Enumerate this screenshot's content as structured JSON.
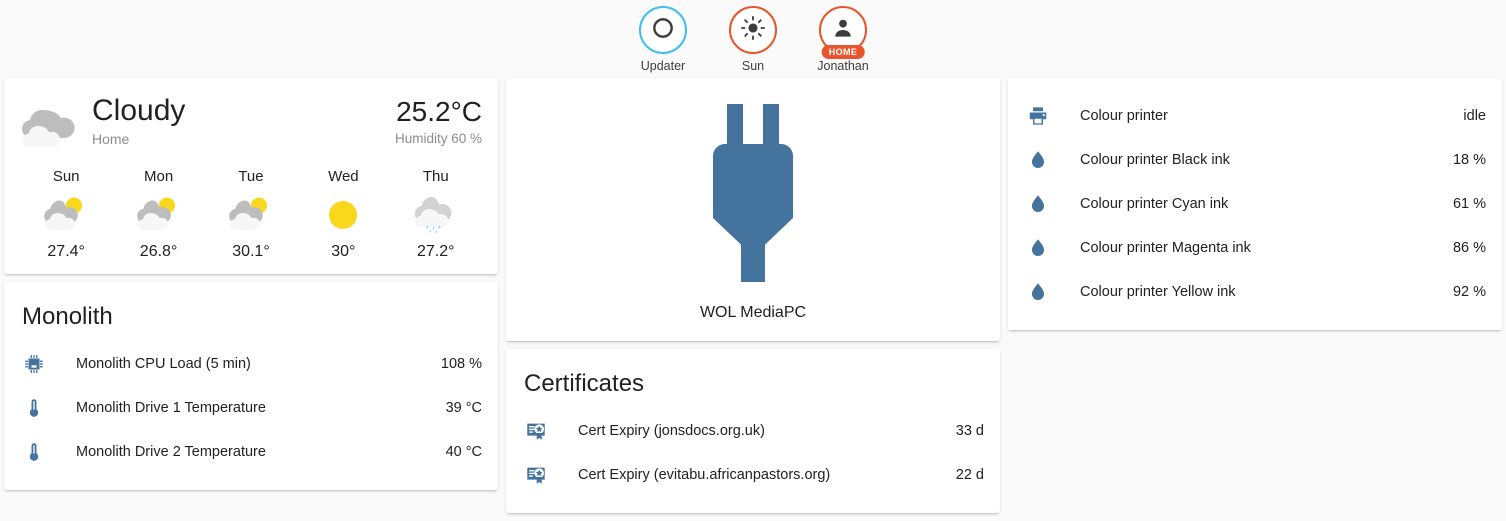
{
  "badges": [
    {
      "name": "Updater",
      "icon": "circle-outline-icon",
      "color": "#41bdf5",
      "pill": null
    },
    {
      "name": "Sun",
      "icon": "sun-icon",
      "color": "#e8552d",
      "pill": null
    },
    {
      "name": "Jonathan",
      "icon": "person-icon",
      "color": "#e8552d",
      "pill": "HOME"
    }
  ],
  "weather": {
    "state": "Cloudy",
    "location": "Home",
    "temperature": "25.2°C",
    "humidity": "Humidity 60 %",
    "icon": "cloudy-icon",
    "forecast": [
      {
        "day": "Sun",
        "icon": "partly-cloudy-icon",
        "temp": "27.4°"
      },
      {
        "day": "Mon",
        "icon": "partly-cloudy-icon",
        "temp": "26.8°"
      },
      {
        "day": "Tue",
        "icon": "partly-cloudy-icon",
        "temp": "30.1°"
      },
      {
        "day": "Wed",
        "icon": "sunny-icon",
        "temp": "30°"
      },
      {
        "day": "Thu",
        "icon": "rainy-icon",
        "temp": "27.2°"
      }
    ]
  },
  "monolith": {
    "title": "Monolith",
    "rows": [
      {
        "icon": "cpu-chip-icon",
        "name": "Monolith CPU Load (5 min)",
        "state": "108 %"
      },
      {
        "icon": "thermometer-icon",
        "name": "Monolith Drive 1 Temperature",
        "state": "39 °C"
      },
      {
        "icon": "thermometer-icon",
        "name": "Monolith Drive 2 Temperature",
        "state": "40 °C"
      }
    ]
  },
  "wol": {
    "label": "WOL MediaPC",
    "icon": "power-plug-icon"
  },
  "certificates": {
    "title": "Certificates",
    "rows": [
      {
        "icon": "certificate-icon",
        "name": "Cert Expiry (jonsdocs.org.uk)",
        "state": "33 d"
      },
      {
        "icon": "certificate-icon",
        "name": "Cert Expiry (evitabu.africanpastors.org)",
        "state": "22 d"
      }
    ]
  },
  "printer": {
    "rows": [
      {
        "icon": "printer-icon",
        "name": "Colour printer",
        "state": "idle"
      },
      {
        "icon": "ink-drop-icon",
        "name": "Colour printer Black ink",
        "state": "18 %"
      },
      {
        "icon": "ink-drop-icon",
        "name": "Colour printer Cyan ink",
        "state": "61 %"
      },
      {
        "icon": "ink-drop-icon",
        "name": "Colour printer Magenta ink",
        "state": "86 %"
      },
      {
        "icon": "ink-drop-icon",
        "name": "Colour printer Yellow ink",
        "state": "92 %"
      }
    ]
  },
  "theme": {
    "accent_blue": "#41bdf5",
    "accent_orange": "#e8552d",
    "icon_blue": "#44739e",
    "sun_yellow": "#f9d71c",
    "cloud_gray": "#bdbdbd",
    "background": "#fafafa",
    "card": "#ffffff"
  }
}
